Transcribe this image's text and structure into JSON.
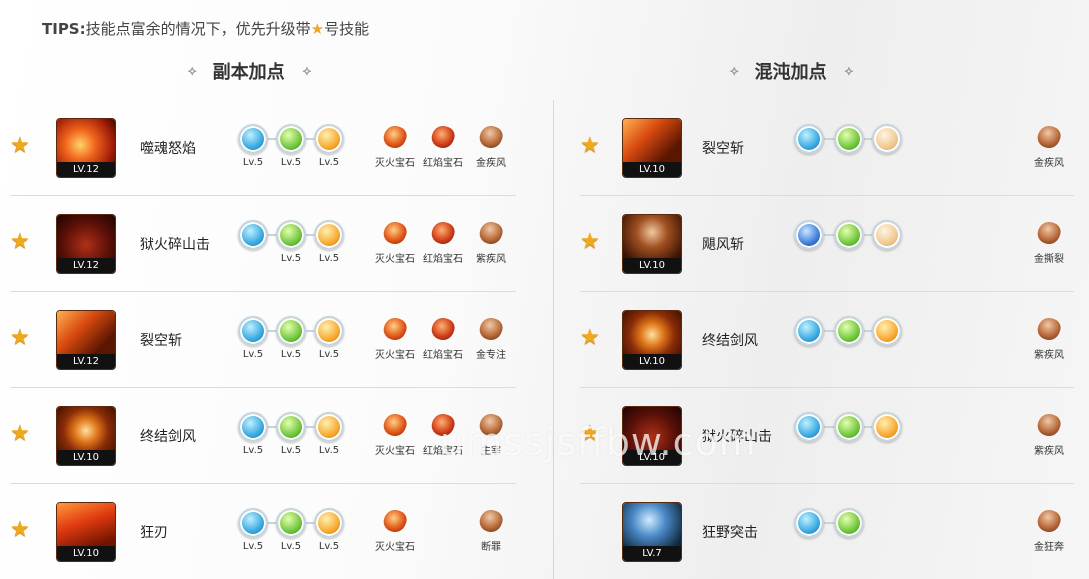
{
  "tips": {
    "head": "TIPS:",
    "text_before": "技能点富余的情况下，优先升级带",
    "star": "★",
    "text_after": "号技能"
  },
  "sections": {
    "left_title": "副本加点",
    "right_title": "混沌加点",
    "deco_left": "⟡",
    "deco_right": "⟡"
  },
  "left_rows": [
    {
      "star": "★",
      "level": "LV.12",
      "name": "噬魂怒焰",
      "runes": [
        {
          "color": "c-blue",
          "label": "Lv.5"
        },
        {
          "color": "c-green",
          "label": "Lv.5"
        },
        {
          "color": "c-orange",
          "label": "Lv.5"
        }
      ],
      "gems": [
        {
          "type": "g-fire",
          "label": "灭火宝石"
        },
        {
          "type": "g-red",
          "label": "红焰宝石"
        },
        {
          "type": "g-brown",
          "label": "金疾风"
        }
      ]
    },
    {
      "star": "★",
      "level": "LV.12",
      "name": "狱火碎山击",
      "runes": [
        {
          "color": "c-blue",
          "label": ""
        },
        {
          "color": "c-green",
          "label": "Lv.5"
        },
        {
          "color": "c-orange",
          "label": "Lv.5"
        }
      ],
      "gems": [
        {
          "type": "g-fire",
          "label": "灭火宝石"
        },
        {
          "type": "g-red",
          "label": "红焰宝石"
        },
        {
          "type": "g-brown",
          "label": "紫疾风"
        }
      ]
    },
    {
      "star": "★",
      "level": "LV.12",
      "name": "裂空斩",
      "runes": [
        {
          "color": "c-blue",
          "label": "Lv.5"
        },
        {
          "color": "c-green",
          "label": "Lv.5"
        },
        {
          "color": "c-orange",
          "label": "Lv.5"
        }
      ],
      "gems": [
        {
          "type": "g-fire",
          "label": "灭火宝石"
        },
        {
          "type": "g-red",
          "label": "红焰宝石"
        },
        {
          "type": "g-brown",
          "label": "金专注"
        }
      ]
    },
    {
      "star": "★",
      "level": "LV.10",
      "name": "终结剑风",
      "runes": [
        {
          "color": "c-blue",
          "label": "Lv.5"
        },
        {
          "color": "c-green",
          "label": "Lv.5"
        },
        {
          "color": "c-orange",
          "label": "Lv.5"
        }
      ],
      "gems": [
        {
          "type": "g-fire",
          "label": "灭火宝石"
        },
        {
          "type": "g-red",
          "label": "红焰宝石"
        },
        {
          "type": "g-brown",
          "label": "主宰"
        }
      ]
    },
    {
      "star": "★",
      "level": "LV.10",
      "name": "狂刃",
      "runes": [
        {
          "color": "c-blue",
          "label": "Lv.5"
        },
        {
          "color": "c-green",
          "label": "Lv.5"
        },
        {
          "color": "c-orange",
          "label": "Lv.5"
        }
      ],
      "gems": [
        {
          "type": "g-fire",
          "label": "灭火宝石"
        },
        {
          "type": "",
          "label": ""
        },
        {
          "type": "g-brown",
          "label": "断罪"
        }
      ]
    }
  ],
  "right_rows": [
    {
      "star": "★",
      "level": "LV.10",
      "name": "裂空斩",
      "runes": [
        {
          "color": "c-blue",
          "label": ""
        },
        {
          "color": "c-green",
          "label": ""
        },
        {
          "color": "c-tan",
          "label": ""
        }
      ],
      "gem": {
        "type": "g-brown",
        "label": "金疾风"
      }
    },
    {
      "star": "★",
      "level": "LV.10",
      "name": "飓风斩",
      "runes": [
        {
          "color": "c-dblue",
          "label": ""
        },
        {
          "color": "c-green",
          "label": ""
        },
        {
          "color": "c-tan",
          "label": ""
        }
      ],
      "gem": {
        "type": "g-brown",
        "label": "金撕裂"
      }
    },
    {
      "star": "★",
      "level": "LV.10",
      "name": "终结剑风",
      "runes": [
        {
          "color": "c-blue",
          "label": ""
        },
        {
          "color": "c-green",
          "label": ""
        },
        {
          "color": "c-orange",
          "label": ""
        }
      ],
      "gem": {
        "type": "g-brown",
        "label": "紫疾风"
      }
    },
    {
      "star": "★",
      "level": "LV.10",
      "name": "狱火碎山击",
      "runes": [
        {
          "color": "c-blue",
          "label": ""
        },
        {
          "color": "c-green",
          "label": ""
        },
        {
          "color": "c-orange",
          "label": ""
        }
      ],
      "gem": {
        "type": "g-brown",
        "label": "紫疾风"
      }
    },
    {
      "star": "",
      "level": "LV.7",
      "name": "狂野突击",
      "runes": [
        {
          "color": "c-blue",
          "label": ""
        },
        {
          "color": "c-green",
          "label": ""
        }
      ],
      "gem": {
        "type": "g-brown",
        "label": "金狂奔"
      }
    }
  ],
  "watermark": "umssjsffbw.com",
  "colors": {
    "star": "#f0a81c",
    "divider": "#dcdcdc"
  }
}
